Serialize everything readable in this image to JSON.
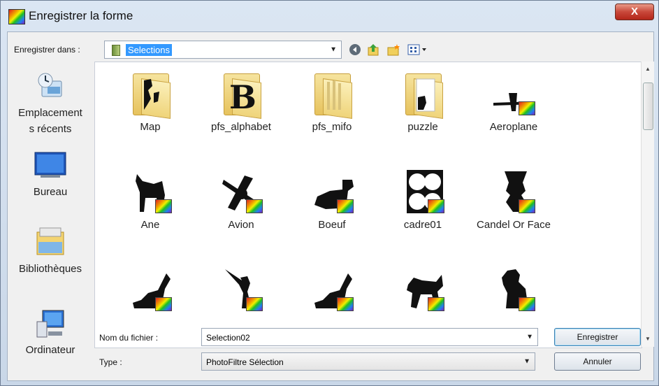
{
  "window": {
    "title": "Enregistrer la forme",
    "close_glyph": "X"
  },
  "toolbar": {
    "save_in_label": "Enregistrer dans :",
    "location": "Selections",
    "icons": [
      "back-icon",
      "up-folder-icon",
      "new-folder-icon",
      "view-menu-icon"
    ]
  },
  "places": [
    {
      "label": "Emplacement\ns récents",
      "icon": "recent-places-icon"
    },
    {
      "label": "Bureau",
      "icon": "desktop-icon"
    },
    {
      "label": "Bibliothèques",
      "icon": "libraries-icon"
    },
    {
      "label": "Ordinateur",
      "icon": "computer-icon"
    }
  ],
  "items": [
    {
      "name": "Map",
      "kind": "folder"
    },
    {
      "name": "pfs_alphabet",
      "kind": "folder"
    },
    {
      "name": "pfs_mifo",
      "kind": "folder"
    },
    {
      "name": "puzzle",
      "kind": "folder"
    },
    {
      "name": "Aeroplane",
      "kind": "file"
    },
    {
      "name": "Ane",
      "kind": "file"
    },
    {
      "name": "Avion",
      "kind": "file"
    },
    {
      "name": "Boeuf",
      "kind": "file"
    },
    {
      "name": "cadre01",
      "kind": "file"
    },
    {
      "name": "Candel Or Face",
      "kind": "file"
    },
    {
      "name": "",
      "kind": "file"
    },
    {
      "name": "",
      "kind": "file"
    },
    {
      "name": "",
      "kind": "file"
    },
    {
      "name": "",
      "kind": "file"
    },
    {
      "name": "",
      "kind": "file"
    }
  ],
  "form": {
    "filename_label": "Nom du fichier :",
    "filename_value": "Selection02",
    "type_label": "Type :",
    "type_value": "PhotoFiltre Sélection",
    "save_button": "Enregistrer",
    "cancel_button": "Annuler"
  }
}
